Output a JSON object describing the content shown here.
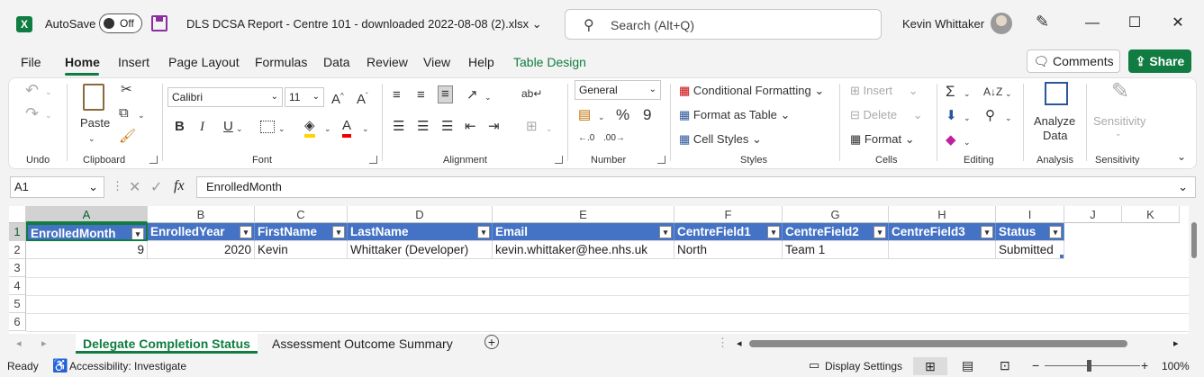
{
  "title_bar": {
    "autosave_label": "AutoSave",
    "autosave_state": "Off",
    "document_title": "DLS DCSA Report - Centre 101 - downloaded 2022-08-08 (2).xlsx",
    "search_placeholder": "Search (Alt+Q)",
    "user_name": "Kevin Whittaker",
    "minimize": "—",
    "maximize": "☐",
    "close": "✕"
  },
  "menu": {
    "tabs": [
      "File",
      "Home",
      "Insert",
      "Page Layout",
      "Formulas",
      "Data",
      "Review",
      "View",
      "Help",
      "Table Design"
    ],
    "active": "Home",
    "comments": "Comments",
    "share": "Share"
  },
  "ribbon": {
    "groups": {
      "undo": "Undo",
      "clipboard": "Clipboard",
      "font": "Font",
      "alignment": "Alignment",
      "number": "Number",
      "styles": "Styles",
      "cells": "Cells",
      "editing": "Editing",
      "analysis": "Analysis",
      "sensitivity": "Sensitivity"
    },
    "paste": "Paste",
    "font_name": "Calibri",
    "font_size": "11",
    "number_format": "General",
    "conditional_formatting": "Conditional Formatting",
    "format_as_table": "Format as Table",
    "cell_styles": "Cell Styles",
    "insert": "Insert",
    "delete": "Delete",
    "format": "Format",
    "analyze_data_1": "Analyze",
    "analyze_data_2": "Data",
    "sensitivity_btn": "Sensitivity"
  },
  "formula_bar": {
    "name_box": "A1",
    "fx": "fx",
    "content": "EnrolledMonth"
  },
  "grid": {
    "columns": [
      "A",
      "B",
      "C",
      "D",
      "E",
      "F",
      "G",
      "H",
      "I",
      "J",
      "K"
    ],
    "rows": [
      "1",
      "2",
      "3",
      "4",
      "5",
      "6"
    ],
    "headers": [
      "EnrolledMonth",
      "EnrolledYear",
      "FirstName",
      "LastName",
      "Email",
      "CentreField1",
      "CentreField2",
      "CentreField3",
      "Status"
    ],
    "row2": [
      "9",
      "2020",
      "Kevin",
      "Whittaker (Developer)",
      "kevin.whittaker@hee.nhs.uk",
      "North",
      "Team 1",
      "",
      "Submitted"
    ]
  },
  "sheets": {
    "tabs": [
      "Delegate Completion Status",
      "Assessment Outcome Summary"
    ],
    "active": "Delegate Completion Status",
    "add": "+"
  },
  "status_bar": {
    "ready": "Ready",
    "accessibility": "Accessibility: Investigate",
    "display_settings": "Display Settings",
    "zoom": "100%"
  },
  "colors": {
    "excel_green": "#107c41",
    "table_header": "#4472c4"
  }
}
